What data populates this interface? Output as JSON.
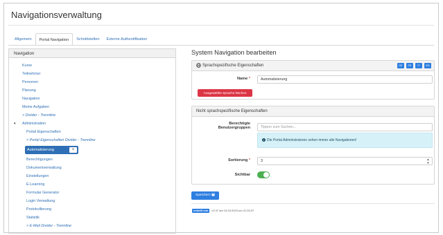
{
  "page": {
    "title": "Navigationsverwaltung"
  },
  "tabs": [
    {
      "label": "Allgemein"
    },
    {
      "label": "Portal Navigation"
    },
    {
      "label": "Schnittstellen"
    },
    {
      "label": "Externe Authentifikation"
    }
  ],
  "nav": {
    "header": "Navigation",
    "items": [
      {
        "label": "Kurse"
      },
      {
        "label": "Teilnehmer"
      },
      {
        "label": "Personen"
      },
      {
        "label": "Planung"
      },
      {
        "label": "Navigation"
      },
      {
        "label": "Meine Aufgaben"
      },
      {
        "label": "> Divider - Trennline"
      },
      {
        "label": "Administration",
        "toggle": "▾"
      },
      {
        "label": "Portal Eigenschaften"
      },
      {
        "label": "> Portal Eigenschaften Divider - Trennline"
      },
      {
        "label": "Automatisierung",
        "remove": "×"
      },
      {
        "label": "Berechtigungen"
      },
      {
        "label": "Dokumentverwaltung"
      },
      {
        "label": "Einstellungen"
      },
      {
        "label": "E-Learning"
      },
      {
        "label": "Formular Generator"
      },
      {
        "label": "Login Verwaltung"
      },
      {
        "label": "Protokollierung"
      },
      {
        "label": "Statistik"
      },
      {
        "label": "> E-Mail Divider - Trennline"
      }
    ]
  },
  "editor": {
    "title": "System Navigation bearbeiten",
    "lang_section": {
      "header": "Sprachspezifische Eigenschaften",
      "languages": [
        "DE",
        "FR",
        "IT",
        "EN"
      ],
      "name_label": "Name",
      "required_mark": "*",
      "name_value": "Automatisierung",
      "delete_button": "Ausgewählte Sprache löschen"
    },
    "general_section": {
      "header": "Nicht sprachspezifische Eigenschaften",
      "groups_label_1": "Berechtigte",
      "groups_label_2": "Benutzergruppen",
      "groups_placeholder": "Tippen zum Suchen...",
      "info_text": "Die Portal Administratoren sehen immer alle Navigationen!",
      "sort_label": "Sortierung",
      "sort_value": "3",
      "visible_label": "Sichtbar",
      "visible": true
    },
    "save_button": "Speichern",
    "created_badge": "erstellt von",
    "created_text": "v3 37 am 13.03.2023 um 21:33:37"
  },
  "colors": {
    "accent": "#2f7fe0",
    "link": "#2f6fb5",
    "danger": "#dc3545",
    "toggle_on": "#4caf50",
    "info_bg": "#d6f1f8"
  },
  "icons": [
    "globe-icon",
    "info-icon",
    "save-icon",
    "chevron-down-icon",
    "close-icon",
    "stepper-icon"
  ]
}
